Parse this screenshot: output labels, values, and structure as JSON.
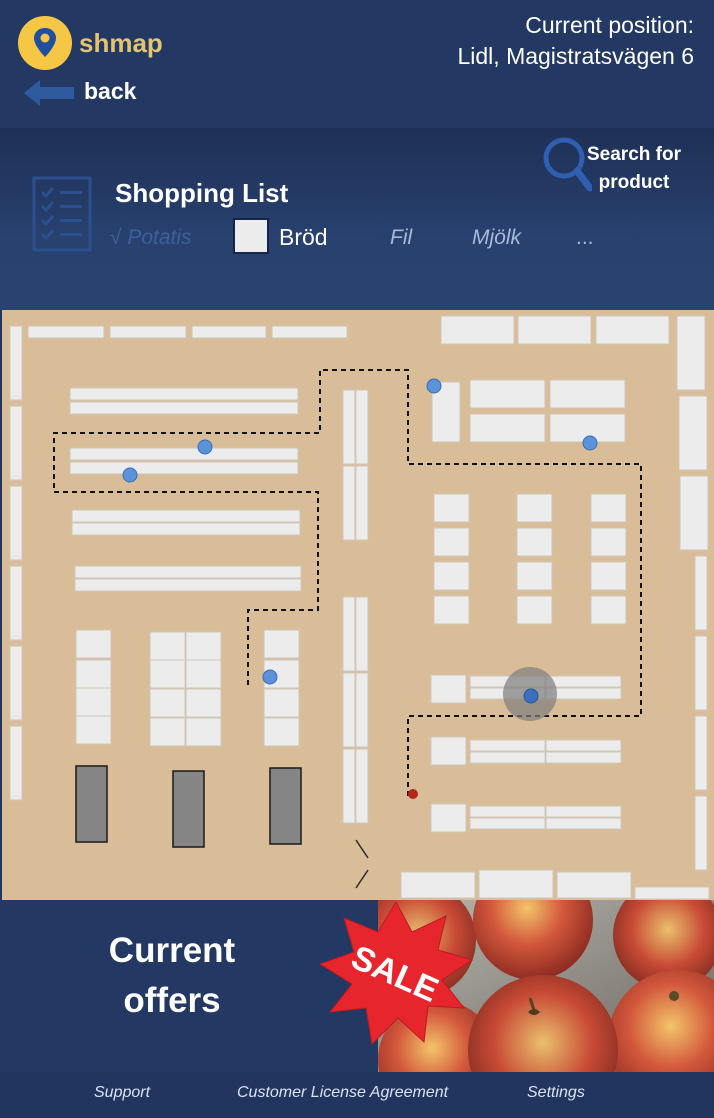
{
  "app": {
    "brand": "shmap",
    "back_label": "back"
  },
  "position": {
    "line1": "Current position:",
    "line2": "Lidl, Magistratsvägen 6"
  },
  "search": {
    "label_line1": "Search for",
    "label_line2": "product"
  },
  "shopping_list": {
    "title": "Shopping List",
    "items": [
      {
        "label": "√ Potatis",
        "state": "done"
      },
      {
        "label": "Bröd",
        "state": "current"
      },
      {
        "label": "Fil",
        "state": "pending"
      },
      {
        "label": "Mjölk",
        "state": "pending"
      },
      {
        "label": "...",
        "state": "more"
      }
    ]
  },
  "offers": {
    "title_line1": "Current",
    "title_line2": "offers",
    "sale_badge": "SALE"
  },
  "footer": {
    "support": "Support",
    "license": "Customer License Agreement",
    "settings": "Settings"
  },
  "colors": {
    "header_bg": "#233862",
    "map_floor": "#d9bd99",
    "shelf": "#ececec",
    "marker": "#5b92d9",
    "start_dot": "#b3261e",
    "logo": "#f6c744",
    "brand_text": "#e3c471"
  }
}
